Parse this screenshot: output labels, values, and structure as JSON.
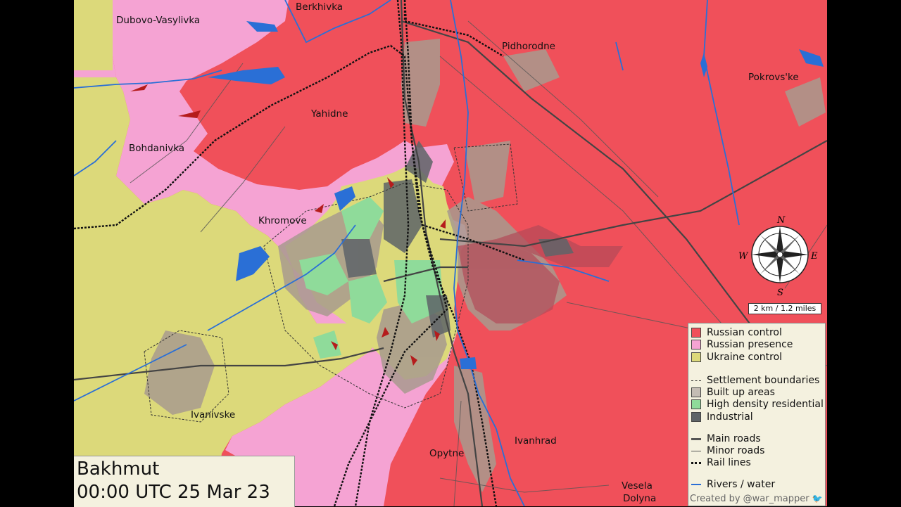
{
  "title": {
    "place": "Bakhmut",
    "timestamp": "00:00 UTC 25 Mar 23"
  },
  "colors": {
    "russian_control": "#f0505a",
    "russian_presence": "#f5a3d3",
    "ukraine_control": "#dcd97a",
    "built_up": "#a89a8e",
    "high_density": "#8fdb9a",
    "industrial": "#5e6468",
    "water": "#2a6fd6",
    "rail": "#111111"
  },
  "places": {
    "berkhivka": "Berkhivka",
    "dubovo": "Dubovo-Vasylivka",
    "pidhorodne": "Pidhorodne",
    "pokrovske": "Pokrovs'ke",
    "yahidne": "Yahidne",
    "bohdanivka": "Bohdanivka",
    "khromove": "Khromove",
    "ivanivske": "Ivanivske",
    "opytne": "Opytne",
    "ivanhrad": "Ivanhrad",
    "vesela1": "Vesela",
    "vesela2": "Dolyna"
  },
  "compass": {
    "n": "N",
    "s": "S",
    "e": "E",
    "w": "W"
  },
  "scale": "2 km / 1.2 miles",
  "legend": {
    "russian_control": "Russian control",
    "russian_presence": "Russian presence",
    "ukraine_control": "Ukraine control",
    "settlement": "Settlement boundaries",
    "built_up": "Built up areas",
    "high_density": "High density residential",
    "industrial": "Industrial",
    "main_roads": "Main roads",
    "minor_roads": "Minor roads",
    "rail": "Rail lines",
    "rivers": "Rivers / water",
    "credit": "Created by @war_mapper"
  }
}
